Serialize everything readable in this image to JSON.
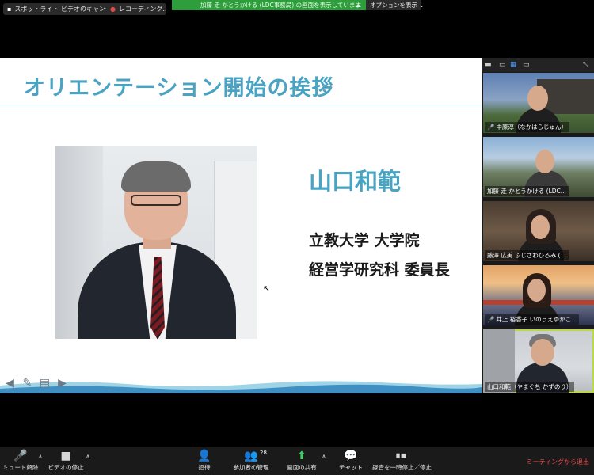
{
  "topbar": {
    "spotlight_cancel": "スポットライト ビデオのキャンセル",
    "recording": "レコーディング...",
    "share_banner": "加藤 走 かとうかける (LDC事務局) の画面を表示しています",
    "options": "オプションを表示",
    "options_caret": "⌄"
  },
  "slide": {
    "title": "オリエンテーション開始の挨拶",
    "speaker_name": "山口和範",
    "affiliation_line1": "立教大学 大学院",
    "affiliation_line2": "経営学研究科 委員長"
  },
  "gallery": {
    "participants": [
      {
        "name": "中原淳（なかはらじゅん）",
        "muted": true
      },
      {
        "name": "加藤 走 かとうかける (LDC...",
        "muted": false
      },
      {
        "name": "藤澤 広美 ふじさわひろみ (...",
        "muted": false
      },
      {
        "name": "井上 裕香子 いのうえゆかこ...",
        "muted": true
      },
      {
        "name": "山口和範（やまぐち かずのり）",
        "muted": false
      }
    ],
    "expand_icon": "⌄"
  },
  "toolbar": {
    "unmute": "ミュート解除",
    "stop_video": "ビデオの停止",
    "invite": "招待",
    "manage_participants": "参加者の管理",
    "participant_count": "28",
    "share_screen": "画面の共有",
    "chat": "チャット",
    "pause_recording": "録音を一時停止／停止",
    "leave": "ミーティングから退出"
  },
  "colors": {
    "slide_accent": "#49a4c3",
    "share_banner_green": "#2e9d3c",
    "leave_red": "#ef4a4a",
    "active_speaker_border": "#b9d94b"
  }
}
